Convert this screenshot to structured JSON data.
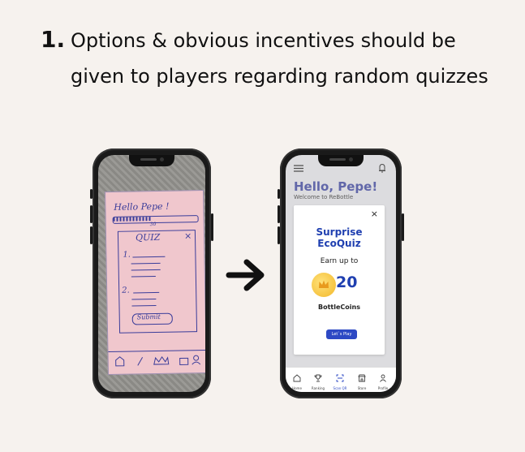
{
  "heading": {
    "number": "1.",
    "line1": "Options & obvious incentives should be",
    "line2": "given to players regarding random quizzes"
  },
  "sketch": {
    "greeting": "Hello Pepe !",
    "progress_number": "30",
    "quiz_label": "QUIZ",
    "close": "×",
    "q1": "1.",
    "q2": "2.",
    "submit": "Submit"
  },
  "app": {
    "greeting": "Hello, Pepe!",
    "subtitle": "Welcome to ReBottle",
    "modal": {
      "close": "×",
      "title": "Surprise EcoQuiz",
      "earn_text": "Earn up to",
      "amount": "20",
      "currency": "BottleCoins",
      "button": "Let`s Play"
    },
    "tabs": [
      {
        "label": "Home",
        "icon": "home-icon"
      },
      {
        "label": "Ranking",
        "icon": "trophy-icon"
      },
      {
        "label": "Scan QR",
        "icon": "scan-icon"
      },
      {
        "label": "Store",
        "icon": "store-icon"
      },
      {
        "label": "Profile",
        "icon": "profile-icon"
      }
    ],
    "colors": {
      "brand": "#2d49c4",
      "greeting": "#6a70b8",
      "coin": "#f2b72a"
    }
  }
}
